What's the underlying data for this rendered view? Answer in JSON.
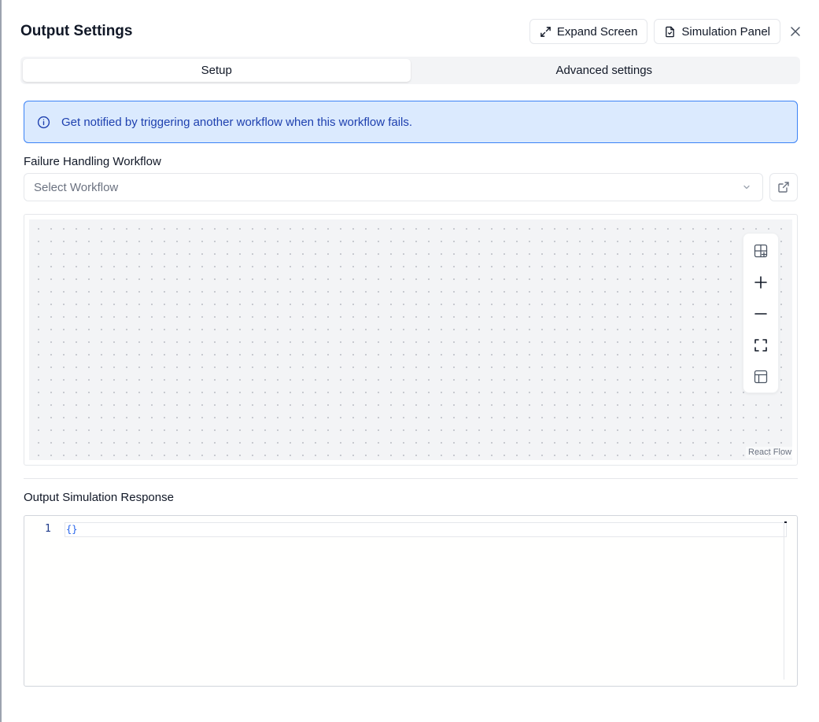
{
  "header": {
    "title": "Output Settings",
    "expand_label": "Expand Screen",
    "simulation_label": "Simulation Panel"
  },
  "tabs": [
    {
      "label": "Setup",
      "active": true
    },
    {
      "label": "Advanced settings",
      "active": false
    }
  ],
  "alert": {
    "text": "Get notified by triggering another workflow when this workflow fails.",
    "icon": "info-icon"
  },
  "failure_workflow": {
    "label": "Failure Handling Workflow",
    "placeholder": "Select Workflow"
  },
  "flow": {
    "attribution": "React Flow",
    "controls": [
      "add-node-icon",
      "zoom-in-icon",
      "zoom-out-icon",
      "fit-view-icon",
      "layout-icon"
    ]
  },
  "simulation": {
    "label": "Output Simulation Response",
    "line_number": "1",
    "code": "{}"
  },
  "colors": {
    "alert_bg": "#dbeafe",
    "alert_border": "#3b82f6",
    "alert_text": "#1e40af",
    "canvas_bg": "#f3f4f6"
  }
}
